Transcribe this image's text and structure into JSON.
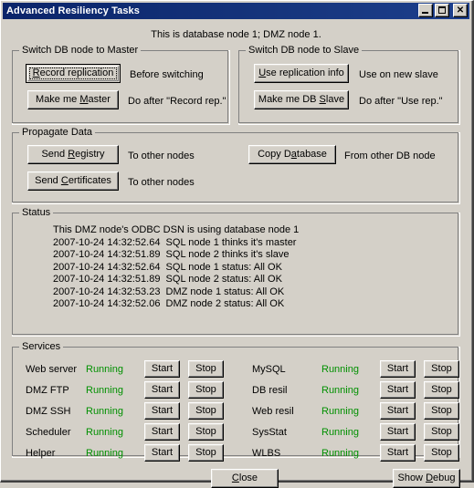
{
  "window": {
    "title": "Advanced Resiliency Tasks",
    "subtitle": "This is database node 1;  DMZ node 1.",
    "minimize_label": "Minimize",
    "maximize_label": "Maximize",
    "close_label": "Close"
  },
  "colors": {
    "titlebar": "#0a246a",
    "face": "#d4d0c8",
    "running": "#009000"
  },
  "switch_master": {
    "title": "Switch DB node to Master",
    "buttons": [
      {
        "label": "Record replication",
        "accel": "R",
        "hint": "Before switching",
        "default": true
      },
      {
        "label": "Make me Master",
        "accel": "M",
        "hint": "Do after \"Record rep.\"",
        "default": false
      }
    ]
  },
  "switch_slave": {
    "title": "Switch DB node to Slave",
    "buttons": [
      {
        "label": "Use replication info",
        "accel": "U",
        "hint": "Use on new slave",
        "default": false
      },
      {
        "label": "Make me DB Slave",
        "accel": "S",
        "hint": "Do after \"Use rep.\"",
        "default": false
      }
    ]
  },
  "propagate": {
    "title": "Propagate Data",
    "left_buttons": [
      {
        "label": "Send Registry",
        "accel": "R",
        "hint": "To other nodes"
      },
      {
        "label": "Send Certificates",
        "accel": "C",
        "hint": "To other nodes"
      }
    ],
    "right_buttons": [
      {
        "label": "Copy Database",
        "accel": "a",
        "hint": "From other DB node"
      }
    ]
  },
  "status": {
    "title": "Status",
    "lines": [
      "This DMZ node's ODBC DSN is using database node 1",
      "2007-10-24 14:32:52.64  SQL node 1 thinks it's master",
      "2007-10-24 14:32:51.89  SQL node 2 thinks it's slave",
      "2007-10-24 14:32:52.64  SQL node 1 status: All OK",
      "2007-10-24 14:32:51.89  SQL node 2 status: All OK",
      "2007-10-24 14:32:53.23  DMZ node 1 status: All OK",
      "2007-10-24 14:32:52.06  DMZ node 2 status: All OK"
    ]
  },
  "services": {
    "title": "Services",
    "start_label": "Start",
    "stop_label": "Stop",
    "left": [
      {
        "name": "Web server",
        "state": "Running"
      },
      {
        "name": "DMZ FTP",
        "state": "Running"
      },
      {
        "name": "DMZ SSH",
        "state": "Running"
      },
      {
        "name": "Scheduler",
        "state": "Running"
      },
      {
        "name": "Helper",
        "state": "Running"
      }
    ],
    "right": [
      {
        "name": "MySQL",
        "state": "Running"
      },
      {
        "name": "DB resil",
        "state": "Running"
      },
      {
        "name": "Web resil",
        "state": "Running"
      },
      {
        "name": "SysStat",
        "state": "Running"
      },
      {
        "name": "WLBS",
        "state": "Running"
      }
    ]
  },
  "footer": {
    "close": {
      "label": "Close",
      "accel": "C"
    },
    "show_debug": {
      "label": "Show Debug",
      "accel": "D"
    }
  }
}
